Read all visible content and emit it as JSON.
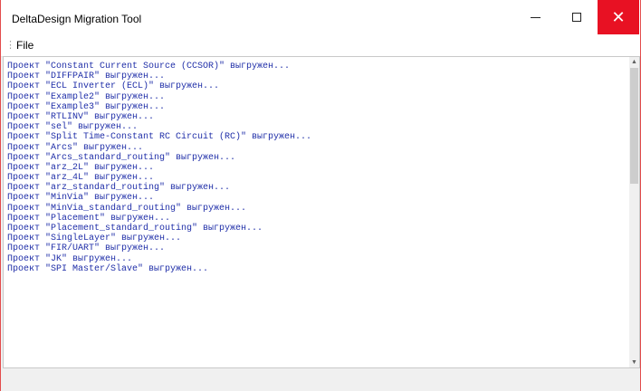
{
  "window": {
    "title": "DeltaDesign Migration Tool",
    "minimize_icon": "minimize-icon",
    "maximize_icon": "maximize-icon",
    "close_icon": "close-icon",
    "close_glyph": "✕",
    "close_color": "#e81123"
  },
  "menu": {
    "grip": "⋮",
    "file_label": "File"
  },
  "log": {
    "text_color": "#1f2ea8",
    "lines": [
      "Проект \"Constant Current Source (CCSOR)\" выгружен...",
      "Проект \"DIFFPAIR\" выгружен...",
      "Проект \"ECL Inverter (ECL)\" выгружен...",
      "Проект \"Example2\" выгружен...",
      "Проект \"Example3\" выгружен...",
      "Проект \"RTLINV\" выгружен...",
      "Проект \"sel\" выгружен...",
      "Проект \"Split Time-Constant RC Circuit (RC)\" выгружен...",
      "Проект \"Arcs\" выгружен...",
      "Проект \"Arcs_standard_routing\" выгружен...",
      "Проект \"arz_2L\" выгружен...",
      "Проект \"arz_4L\" выгружен...",
      "Проект \"arz_standard_routing\" выгружен...",
      "Проект \"MinVia\" выгружен...",
      "Проект \"MinVia_standard_routing\" выгружен...",
      "Проект \"Placement\" выгружен...",
      "Проект \"Placement_standard_routing\" выгружен...",
      "Проект \"SingleLayer\" выгружен...",
      "Проект \"FIR/UART\" выгружен...",
      "Проект \"JK\" выгружен...",
      "Проект \"SPI Master/Slave\" выгружен..."
    ]
  },
  "scrollbar": {
    "up_glyph": "▲",
    "down_glyph": "▼"
  }
}
